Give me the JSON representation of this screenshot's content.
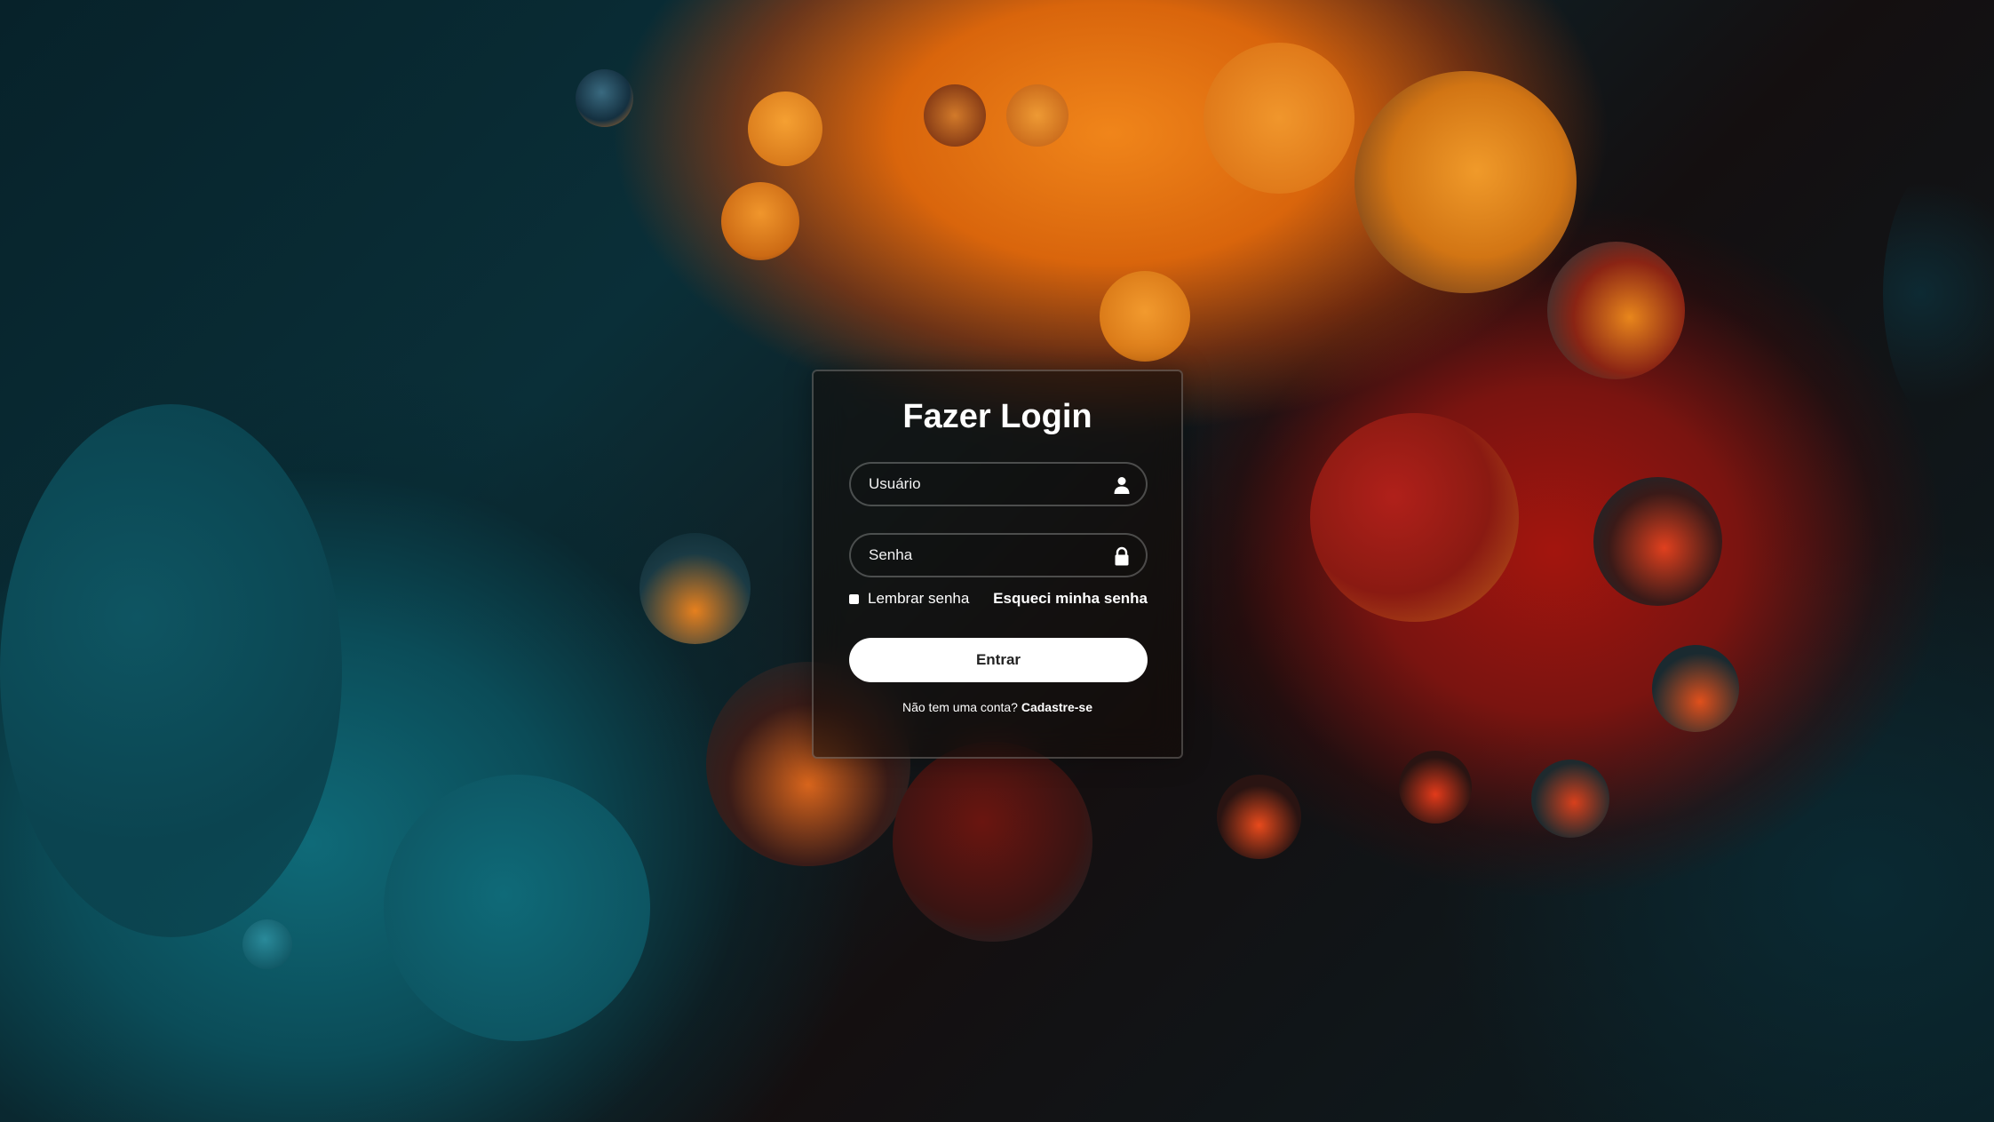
{
  "login": {
    "title": "Fazer Login",
    "username_placeholder": "Usuário",
    "password_placeholder": "Senha",
    "remember_label": "Lembrar senha",
    "forgot_link": "Esqueci minha senha",
    "submit_label": "Entrar",
    "signup_prompt": "Não tem uma conta?",
    "signup_link": "Cadastre-se"
  },
  "icons": {
    "username": "user-icon",
    "password": "lock-icon"
  },
  "colors": {
    "button_bg": "#ffffff",
    "text": "#ffffff",
    "bg_orange": "#e07114",
    "bg_red": "#9b1510",
    "bg_teal": "#0f6a78"
  }
}
